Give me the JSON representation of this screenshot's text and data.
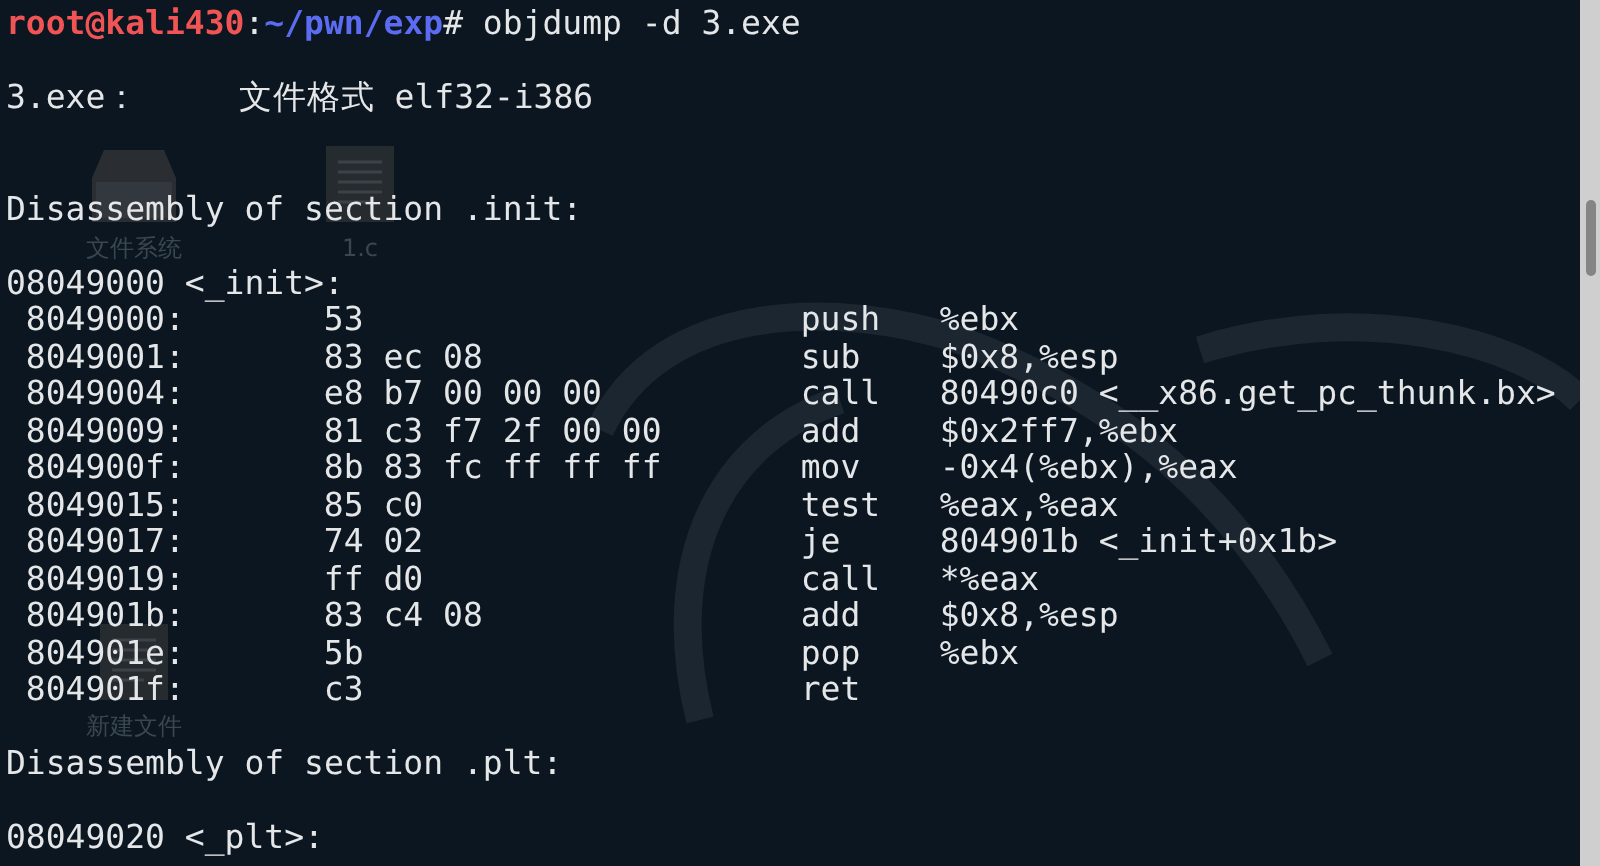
{
  "desktop": {
    "icons": [
      {
        "kind": "drive",
        "label": "文件系统"
      },
      {
        "kind": "document",
        "label": "1.c"
      },
      {
        "kind": "document",
        "label": "新建文件"
      }
    ]
  },
  "terminal": {
    "prompt": {
      "user_host": "root@kali430",
      "separator": ":",
      "path": "~/pwn/exp",
      "symbol": "#",
      "command": "objdump -d 3.exe"
    },
    "lines": [
      {
        "kind": "blank"
      },
      {
        "kind": "text",
        "text": "3.exe：     文件格式 elf32-i386"
      },
      {
        "kind": "blank"
      },
      {
        "kind": "blank"
      },
      {
        "kind": "text",
        "text": "Disassembly of section .init:"
      },
      {
        "kind": "blank"
      },
      {
        "kind": "text",
        "text": "08049000 <_init>:"
      },
      {
        "kind": "instruction",
        "address": "8049000:",
        "bytes": "53",
        "mnemonic": "push",
        "operand": "%ebx"
      },
      {
        "kind": "instruction",
        "address": "8049001:",
        "bytes": "83 ec 08",
        "mnemonic": "sub",
        "operand": "$0x8,%esp"
      },
      {
        "kind": "instruction",
        "address": "8049004:",
        "bytes": "e8 b7 00 00 00",
        "mnemonic": "call",
        "operand": "80490c0 <__x86.get_pc_thunk.bx>"
      },
      {
        "kind": "instruction",
        "address": "8049009:",
        "bytes": "81 c3 f7 2f 00 00",
        "mnemonic": "add",
        "operand": "$0x2ff7,%ebx"
      },
      {
        "kind": "instruction",
        "address": "804900f:",
        "bytes": "8b 83 fc ff ff ff",
        "mnemonic": "mov",
        "operand": "-0x4(%ebx),%eax"
      },
      {
        "kind": "instruction",
        "address": "8049015:",
        "bytes": "85 c0",
        "mnemonic": "test",
        "operand": "%eax,%eax"
      },
      {
        "kind": "instruction",
        "address": "8049017:",
        "bytes": "74 02",
        "mnemonic": "je",
        "operand": "804901b <_init+0x1b>"
      },
      {
        "kind": "instruction",
        "address": "8049019:",
        "bytes": "ff d0",
        "mnemonic": "call",
        "operand": "*%eax"
      },
      {
        "kind": "instruction",
        "address": "804901b:",
        "bytes": "83 c4 08",
        "mnemonic": "add",
        "operand": "$0x8,%esp"
      },
      {
        "kind": "instruction",
        "address": "804901e:",
        "bytes": "5b",
        "mnemonic": "pop",
        "operand": "%ebx"
      },
      {
        "kind": "instruction",
        "address": "804901f:",
        "bytes": "c3",
        "mnemonic": "ret"
      },
      {
        "kind": "blank"
      },
      {
        "kind": "text",
        "text": "Disassembly of section .plt:"
      },
      {
        "kind": "blank"
      },
      {
        "kind": "text",
        "text": "08049020 <_plt>:"
      }
    ]
  }
}
